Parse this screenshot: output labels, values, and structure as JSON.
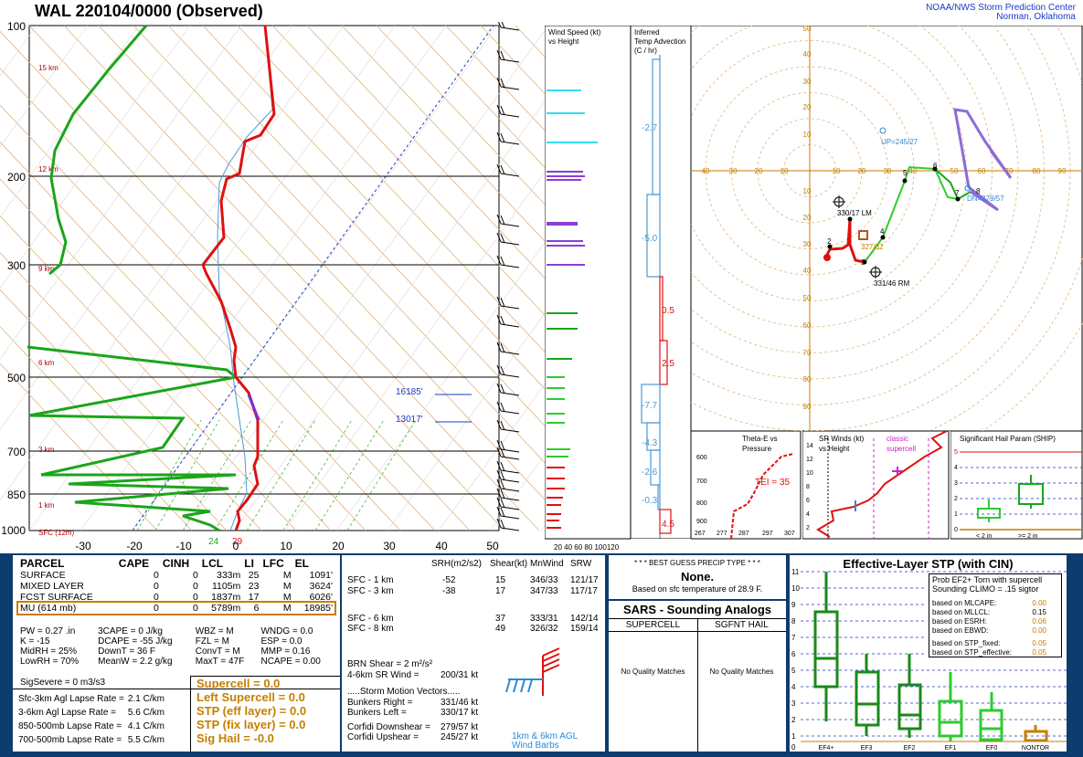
{
  "header": {
    "title": "WAL   220104/0000  (Observed)",
    "org_line1": "NOAA/NWS Storm Prediction Center",
    "org_line2": "Norman, Oklahoma"
  },
  "skewt": {
    "pressure_labels": [
      "100",
      "200",
      "300",
      "500",
      "700",
      "850",
      "1000"
    ],
    "height_labels": [
      "15 km",
      "12 km",
      "9 km",
      "6 km",
      "3 km",
      "1 km",
      "SFC (12m)"
    ],
    "temp_ticks": [
      "-30",
      "-20",
      "-10",
      "0",
      "10",
      "20",
      "30",
      "40",
      "50"
    ],
    "sfc_td": "24",
    "sfc_t": "29",
    "lvl1_label": "16185'",
    "lvl2_label": "13017'"
  },
  "wind_speed_panel": {
    "title_line1": "Wind Speed (kt)",
    "title_line2": "vs Height",
    "x_ticks": "20 40 60 80 100120"
  },
  "temp_adv_panel": {
    "title_line1": "Inferred",
    "title_line2": "Temp Advection",
    "title_line3": "(C / hr)",
    "values": [
      "-2.7",
      "-5.0",
      "0.5",
      "2.5",
      "-7.7",
      "-4.3",
      "-2.6",
      "-0.3",
      "4.5"
    ]
  },
  "hodograph": {
    "rings_x": [
      "40",
      "30",
      "20",
      "10",
      "10",
      "20",
      "30",
      "40",
      "50",
      "60",
      "70",
      "80",
      "90"
    ],
    "rings_y_top": [
      "50",
      "40",
      "30",
      "20",
      "10"
    ],
    "rings_y_bot": [
      "10",
      "20",
      "30",
      "40",
      "50",
      "60",
      "70",
      "80",
      "90"
    ],
    "up_label": "UP=245/27",
    "dn_label": "DN=279/57",
    "lm_label": "330/17 LM",
    "rm_label": "331/46 RM",
    "mean_label": "327/32",
    "pt_labels": [
      "2",
      "3",
      "4",
      "5",
      "6",
      "7",
      "8"
    ]
  },
  "theta_panel": {
    "title_line1": "Theta-E vs",
    "title_line2": "Pressure",
    "tei": "TEI = 35",
    "p_ticks": [
      "600",
      "700",
      "800",
      "900"
    ],
    "t_ticks": [
      "267",
      "277",
      "287",
      "297",
      "307"
    ]
  },
  "sr_wind_panel": {
    "title_line1": "SR Winds (kt)",
    "title_line2": "vs Height",
    "classic": "classic",
    "supercell": "supercell",
    "h_ticks": [
      "14",
      "12",
      "10",
      "8",
      "6",
      "4",
      "2"
    ]
  },
  "ship_panel": {
    "title": "Significant Hail Param (SHIP)",
    "y_ticks": [
      "5",
      "4",
      "3",
      "2",
      "1",
      "0"
    ],
    "cat1": "< 2 in",
    "cat2": ">= 2 in"
  },
  "parcel_table": {
    "headers": [
      "PARCEL",
      "CAPE",
      "CINH",
      "LCL",
      "LI",
      "LFC",
      "EL"
    ],
    "rows": [
      [
        "SURFACE",
        "0",
        "0",
        "333m",
        "25",
        "M",
        "1091'"
      ],
      [
        "MIXED LAYER",
        "0",
        "0",
        "1105m",
        "23",
        "M",
        "3624'"
      ],
      [
        "FCST SURFACE",
        "0",
        "0",
        "1837m",
        "17",
        "M",
        "6026'"
      ],
      [
        "MU   (614 mb)",
        "0",
        "0",
        "5789m",
        "6",
        "M",
        "18985'"
      ]
    ],
    "params": [
      [
        "PW = 0.27 .in",
        "3CAPE = 0 J/kg",
        "WBZ = M",
        "WNDG = 0.0"
      ],
      [
        "K = -15",
        "DCAPE = -55 J/kg",
        "FZL = M",
        "ESP = 0.0"
      ],
      [
        "MidRH = 25%",
        "DownT = 36 F",
        "ConvT = M",
        "MMP = 0.16"
      ],
      [
        "LowRH = 70%",
        "MeanW = 2.2 g/kg",
        "MaxT = 47F",
        "NCAPE = 0.00"
      ]
    ],
    "sigsevere": "SigSevere = 0 m3/s3",
    "lapse": [
      [
        "Sfc-3km Agl Lapse Rate =",
        "2.1 C/km"
      ],
      [
        "3-6km Agl Lapse Rate =",
        "5.6 C/km"
      ],
      [
        "850-500mb Lapse Rate =",
        "4.1 C/km"
      ],
      [
        "700-500mb Lapse Rate =",
        "5.5 C/km"
      ]
    ],
    "composites": [
      "Supercell = 0.0",
      "Left Supercell = 0.0",
      "STP (eff layer) = 0.0",
      "STP (fix layer) = 0.0",
      "Sig Hail = -0.0"
    ]
  },
  "kinematic_table": {
    "headers": [
      "SRH(m2/s2)",
      "Shear(kt)",
      "MnWind",
      "SRW"
    ],
    "rows": [
      [
        "SFC - 1 km",
        "-52",
        "15",
        "346/33",
        "121/17"
      ],
      [
        "SFC - 3 km",
        "-38",
        "17",
        "347/33",
        "117/17"
      ],
      [
        "SFC - 6 km",
        "",
        "37",
        "333/31",
        "142/14"
      ],
      [
        "SFC - 8 km",
        "",
        "49",
        "326/32",
        "159/14"
      ]
    ],
    "brn": "BRN Shear =  2 m²/s²",
    "sr46": "4-6km SR Wind =",
    "sr46_val": "200/31 kt",
    "motion_title": ".....Storm Motion Vectors.....",
    "motion": [
      [
        "Bunkers Right =",
        "331/46 kt"
      ],
      [
        "Bunkers Left =",
        "330/17 kt"
      ],
      [
        "Corfidi Downshear =",
        "279/57 kt"
      ],
      [
        "Corfidi Upshear =",
        "245/27 kt"
      ]
    ],
    "barb_label1": "1km & 6km AGL",
    "barb_label2": "Wind Barbs"
  },
  "precip": {
    "title": "* * * BEST GUESS PRECIP TYPE * * *",
    "value": "None.",
    "note": "Based on sfc temperature of 28.9 F."
  },
  "sars": {
    "title": "SARS - Sounding Analogs",
    "col1": "SUPERCELL",
    "col2": "SGFNT HAIL",
    "msg1": "No Quality Matches",
    "msg2": "No Quality Matches"
  },
  "stp_panel": {
    "title": "Effective-Layer STP (with CIN)",
    "prob_line1": "Prob EF2+ Torn with supercell",
    "prob_line2": "Sounding CLIMO = .15 sigtor",
    "rows": [
      [
        "based on MLCAPE:",
        "0.00"
      ],
      [
        "based on MLLCL:",
        "0.15"
      ],
      [
        "based on ESRH:",
        "0.06"
      ],
      [
        "based on EBWD:",
        "0.00"
      ],
      [
        "based on STP_fixed:",
        "0.05"
      ],
      [
        "based on STP_effective:",
        "0.05"
      ]
    ],
    "y_ticks": [
      "11",
      "10",
      "9",
      "8",
      "7",
      "6",
      "5",
      "4",
      "3",
      "2",
      "1",
      "0"
    ],
    "cats": [
      "EF4+",
      "EF3",
      "EF2",
      "EF1",
      "EF0",
      "NONTOR"
    ]
  }
}
